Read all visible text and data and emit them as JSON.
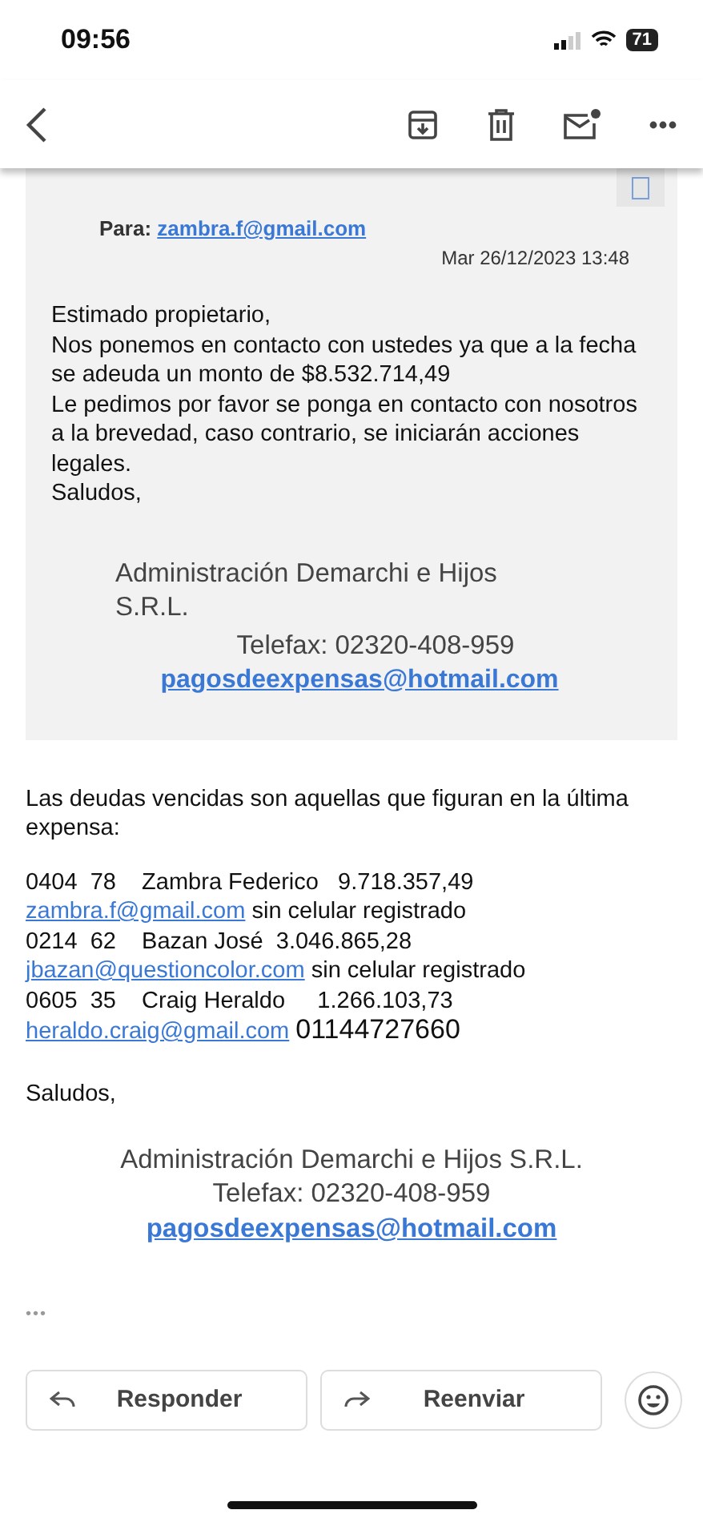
{
  "status_bar": {
    "time": "09:56",
    "battery": "71"
  },
  "toolbar": {
    "actions": [
      {
        "kind": "archive"
      },
      {
        "kind": "delete"
      },
      {
        "kind": "unread"
      },
      {
        "kind": "more"
      }
    ]
  },
  "quoted": {
    "to_label": "Para:",
    "to": "zambra.f@gmail.com",
    "date": "Mar 26/12/2023 13:48",
    "body": [
      "Estimado propietario,",
      "Nos ponemos en contacto con ustedes ya que a la fecha",
      "se adeuda un monto de $8.532.714,49",
      "Le pedimos por favor se ponga en contacto con nosotros",
      "a la brevedad, caso contrario, se iniciarán acciones",
      "legales.",
      "Saludos,"
    ],
    "signature": {
      "company": [
        "Administración Demarchi e Hijos",
        "S.R.L."
      ],
      "phone": "Telefax: 02320-408-959",
      "email": "pagosdeexpensas@hotmail.com"
    }
  },
  "intro": [
    "Las deudas vencidas son aquellas que figuran en la última",
    "expensa:"
  ],
  "debtors": [
    {
      "line": "0404  78    Zambra Federico   9.718.357,49",
      "email": "zambra.f@gmail.com",
      "contact": "sin celular registrado",
      "kind": "note"
    },
    {
      "line": "0214  62    Bazan José  3.046.865,28",
      "email": "jbazan@questioncolor.com",
      "contact": "sin celular registrado",
      "kind": "note"
    },
    {
      "line": "0605  35    Craig Heraldo     1.266.103,73",
      "email": "heraldo.craig@gmail.com",
      "contact": "01144727660",
      "kind": "phone"
    }
  ],
  "closing": "Saludos,",
  "signature": {
    "company": "Administración Demarchi e Hijos S.R.L.",
    "phone": "Telefax: 02320-408-959",
    "email": "pagosdeexpensas@hotmail.com"
  },
  "more": "•••",
  "actions": [
    {
      "label": "Responder",
      "kind": "reply"
    },
    {
      "label": "Reenviar",
      "kind": "forward"
    }
  ]
}
